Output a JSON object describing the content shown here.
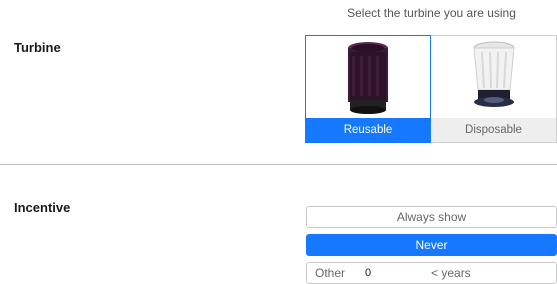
{
  "turbine": {
    "section_label": "Turbine",
    "hint": "Select the turbine you are using",
    "options": [
      {
        "label": "Reusable",
        "selected": true,
        "image": "reusable-turbine-image"
      },
      {
        "label": "Disposable",
        "selected": false,
        "image": "disposable-turbine-image"
      }
    ]
  },
  "incentive": {
    "section_label": "Incentive",
    "options": {
      "always": "Always show",
      "never": "Never",
      "other_label": "Other",
      "other_value": "0",
      "other_unit": "< years"
    },
    "selected": "never"
  },
  "colors": {
    "accent": "#1677ff",
    "unselected_caption_bg": "#eeeeee"
  }
}
